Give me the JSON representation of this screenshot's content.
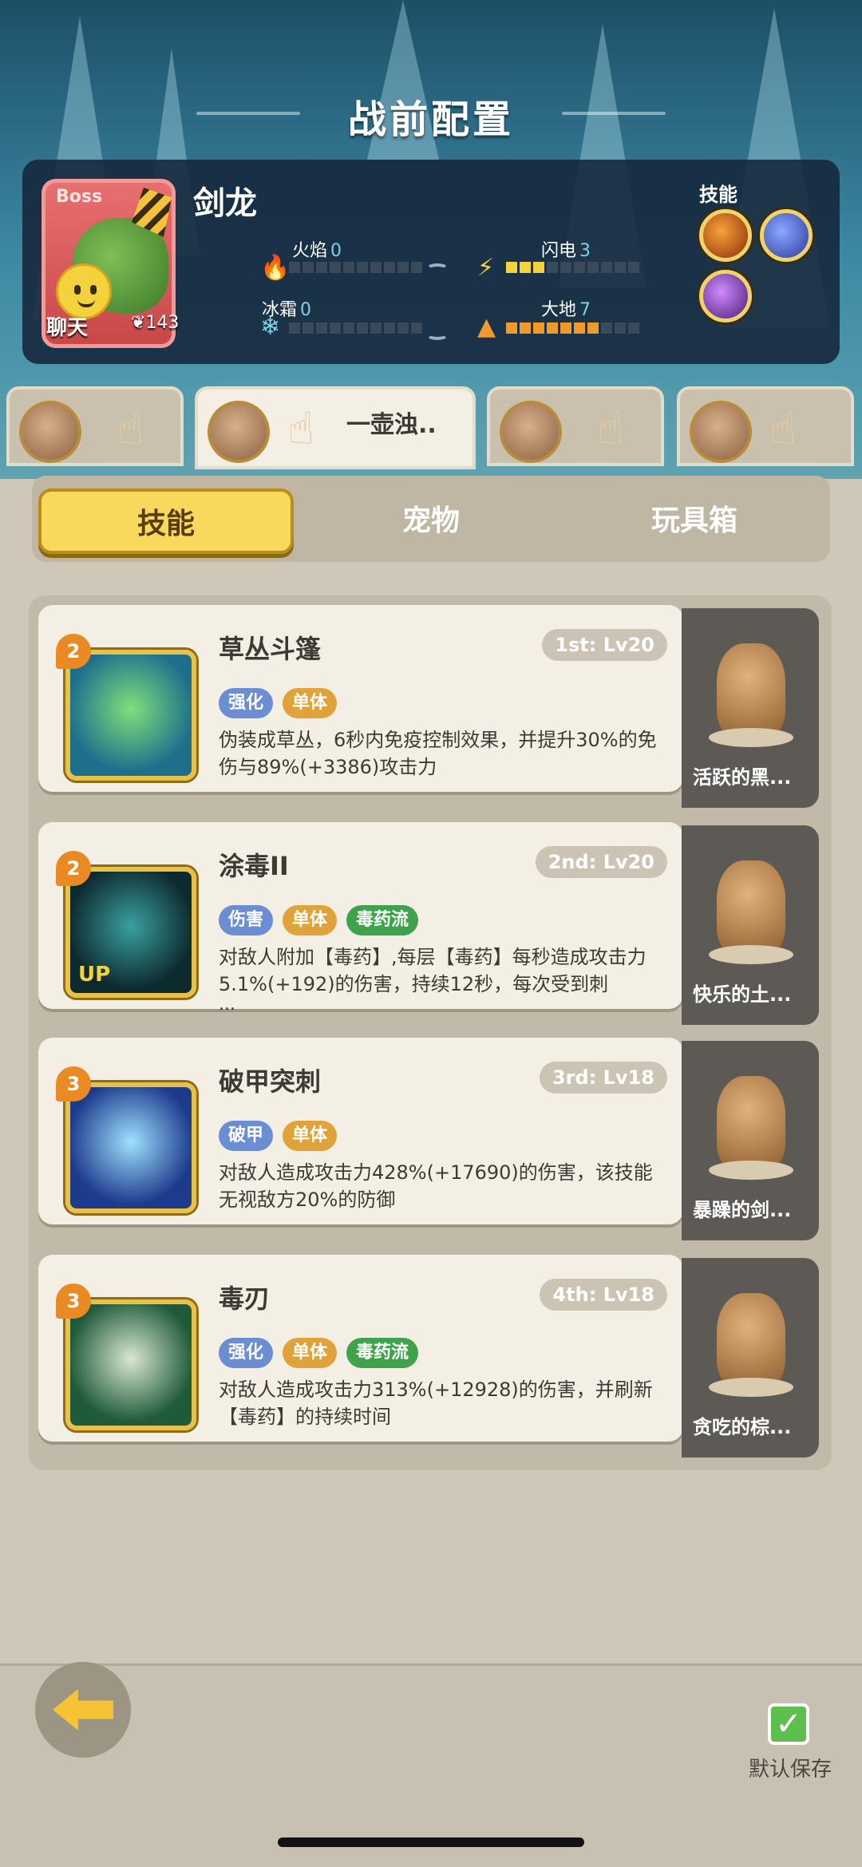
{
  "header": {
    "title": "战前配置"
  },
  "boss": {
    "tag": "Boss",
    "name": "剑龙",
    "chat_label": "聊天",
    "power": "143",
    "elements": [
      {
        "name": "火焰",
        "level": "0",
        "filled": 0,
        "color": "#f5d33a"
      },
      {
        "name": "闪电",
        "level": "3",
        "filled": 3,
        "color": "#f5d33a"
      },
      {
        "name": "冰霜",
        "level": "0",
        "filled": 0,
        "color": "#f5d33a"
      },
      {
        "name": "大地",
        "level": "7",
        "filled": 7,
        "color": "#ef9a2d"
      }
    ],
    "skills_label": "技能"
  },
  "char_tabs": [
    {
      "label": ""
    },
    {
      "label": "一壶浊.."
    },
    {
      "label": ""
    },
    {
      "label": ""
    }
  ],
  "segment": {
    "tabs": [
      "技能",
      "宠物",
      "玩具箱"
    ],
    "active": 0
  },
  "skills": [
    {
      "rank": "2",
      "name": "草丛斗篷",
      "slot": "1st: Lv20",
      "tags": [
        {
          "t": "强化",
          "c": "blue"
        },
        {
          "t": "单体",
          "c": "orange"
        }
      ],
      "desc": "伪装成草丛，6秒内免疫控制效果，并提升30%的免伤与89%(+3386)攻击力",
      "more": ""
    },
    {
      "rank": "2",
      "name": "涂毒II",
      "slot": "2nd: Lv20",
      "tags": [
        {
          "t": "伤害",
          "c": "blue"
        },
        {
          "t": "单体",
          "c": "orange"
        },
        {
          "t": "毒药流",
          "c": "green"
        }
      ],
      "desc": "对敌人附加【毒药】,每层【毒药】每秒造成攻击力5.1%(+192)的伤害，持续12秒，每次受到刺",
      "more": "...",
      "up": "UP"
    },
    {
      "rank": "3",
      "name": "破甲突刺",
      "slot": "3rd: Lv18",
      "tags": [
        {
          "t": "破甲",
          "c": "blue"
        },
        {
          "t": "单体",
          "c": "orange"
        }
      ],
      "desc": "对敌人造成攻击力428%(+17690)的伤害，该技能无视敌方20%的防御",
      "more": ""
    },
    {
      "rank": "3",
      "name": "毒刃",
      "slot": "4th: Lv18",
      "tags": [
        {
          "t": "强化",
          "c": "blue"
        },
        {
          "t": "单体",
          "c": "orange"
        },
        {
          "t": "毒药流",
          "c": "green"
        }
      ],
      "desc": "对敌人造成攻击力313%(+12928)的伤害，并刷新【毒药】的持续时间",
      "more": ""
    }
  ],
  "pets": [
    {
      "name": "活跃的黑..."
    },
    {
      "name": "快乐的土..."
    },
    {
      "name": "暴躁的剑..."
    },
    {
      "name": "贪吃的棕..."
    }
  ],
  "footer": {
    "save_label": "默认保存"
  }
}
